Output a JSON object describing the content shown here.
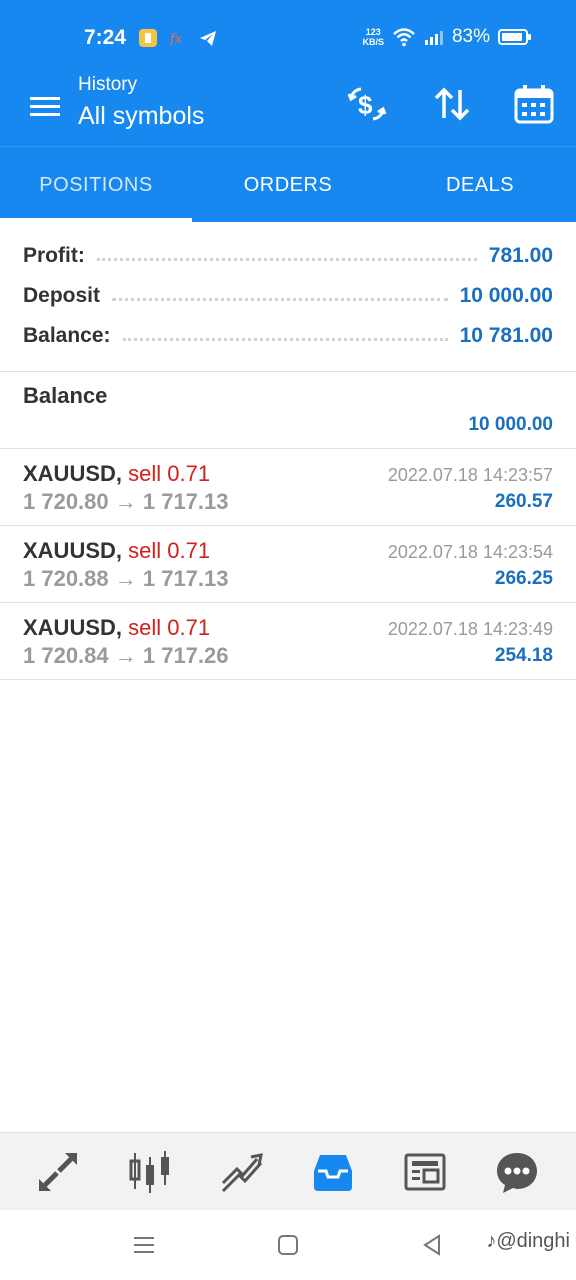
{
  "status": {
    "time": "7:24",
    "netspeed_top": "123",
    "netspeed_bottom": "KB/S",
    "battery": "83%"
  },
  "app_bar": {
    "subtitle": "History",
    "title": "All symbols",
    "icons": [
      "menu-icon",
      "currency-exchange-icon",
      "sort-icon",
      "calendar-icon"
    ]
  },
  "tabs": [
    {
      "label": "POSITIONS",
      "active": true
    },
    {
      "label": "ORDERS",
      "active": false
    },
    {
      "label": "DEALS",
      "active": false
    }
  ],
  "summary": {
    "profit_label": "Profit:",
    "profit_value": "781.00",
    "deposit_label": "Deposit",
    "deposit_value": "10 000.00",
    "balance_label": "Balance:",
    "balance_value": "10 781.00"
  },
  "balance_entry": {
    "title": "Balance",
    "value": "10 000.00"
  },
  "deals": [
    {
      "symbol": "XAUUSD,",
      "side": "sell 0.71",
      "prices": "1 720.80 → 1 717.13",
      "time": "2022.07.18 14:23:57",
      "profit": "260.57"
    },
    {
      "symbol": "XAUUSD,",
      "side": "sell 0.71",
      "prices": "1 720.88 → 1 717.13",
      "time": "2022.07.18 14:23:54",
      "profit": "266.25"
    },
    {
      "symbol": "XAUUSD,",
      "side": "sell 0.71",
      "prices": "1 720.84 → 1 717.26",
      "time": "2022.07.18 14:23:49",
      "profit": "254.18"
    }
  ],
  "bottom_nav": [
    "quotes-icon",
    "chart-icon",
    "trade-icon",
    "history-icon",
    "news-icon",
    "chat-icon"
  ],
  "watermark": "♪@dinghi",
  "colors": {
    "primary": "#1788f0",
    "value_blue": "#1a6fc0",
    "sell_red": "#d0201c",
    "active_nav": "#1788f0"
  }
}
